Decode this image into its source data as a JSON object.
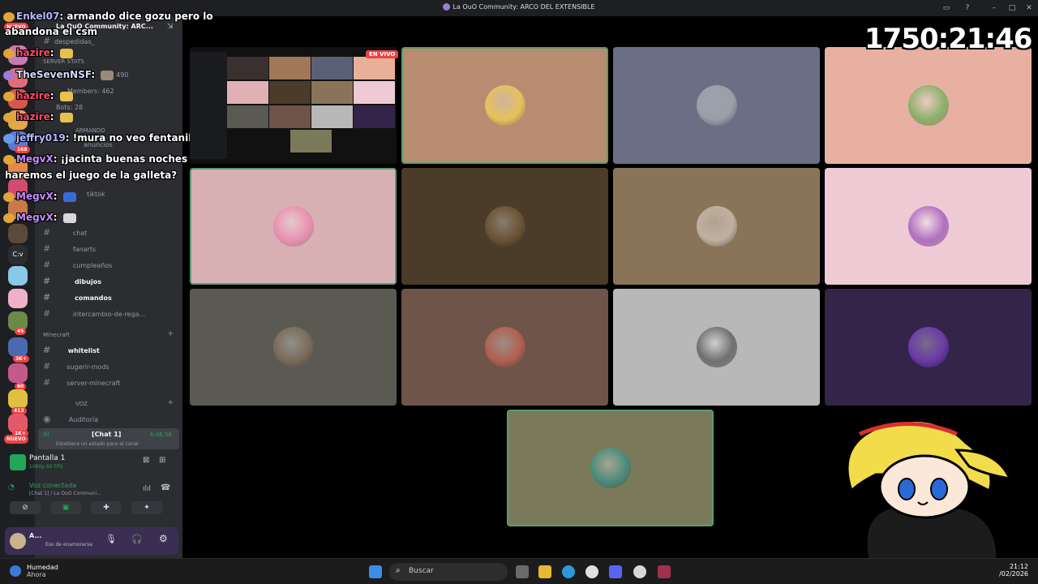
{
  "window": {
    "title": "La OuO Community: ARCO DEL EXTENSIBLE"
  },
  "rail": {
    "badges": [
      "168",
      "45",
      "3K+",
      "60",
      "413",
      "1K+"
    ],
    "nuevo": "NUEVO",
    "cv_label": "C:v"
  },
  "sidebar": {
    "server_name": "La OuO Community: ARC...",
    "channels": [
      {
        "name": "despedidas_",
        "bold": false
      },
      {
        "name": "SERVER STATS",
        "bold": false
      },
      {
        "name": "Members: 462",
        "bold": false
      },
      {
        "name": "Bots: 28",
        "bold": false
      },
      {
        "name": "anuncios",
        "bold": false
      },
      {
        "name": "tiktok",
        "bold": false
      },
      {
        "name": "chat",
        "bold": false
      },
      {
        "name": "fanarts",
        "bold": false
      },
      {
        "name": "cumpleaños",
        "bold": false
      },
      {
        "name": "dibujos",
        "bold": true
      },
      {
        "name": "comandos",
        "bold": true
      },
      {
        "name": "intercambio-de-rega...",
        "bold": false
      }
    ],
    "category_minecraft": "Minecraft",
    "mc_channels": [
      {
        "name": "whitelist",
        "bold": true
      },
      {
        "name": "sugerir-mods",
        "bold": false
      },
      {
        "name": "server-minecraft",
        "bold": false
      }
    ],
    "category_voz": "VOZ",
    "auditoria": "Auditoría",
    "chat1": {
      "name": "[Chat 1]",
      "time": "6:06:56",
      "status": "Establece un estado para el canal"
    },
    "stats_label": "RV: 490",
    "armando_label": "ARMANDO"
  },
  "screen_share": {
    "title": "Pantalla 1",
    "quality": "1080p 60 FPS"
  },
  "voice": {
    "status": "Voz conectada",
    "channel": "[Chat 1] / La OuO Communi..."
  },
  "user": {
    "name": "A...",
    "status": "Eso de enamorarse"
  },
  "chat_overlay": [
    {
      "user": "Enkel07",
      "color": "#b6b9ff",
      "text": "armando dice gozu pero lo"
    },
    {
      "user": "",
      "color": "#fff",
      "text": "abandona el csm"
    },
    {
      "user": "hazire",
      "color": "#ff4a6d",
      "text": ""
    },
    {
      "user": "TheSevenNSF",
      "color": "#d8d8ff",
      "text": ""
    },
    {
      "user": "hazire",
      "color": "#ff4a6d",
      "text": ""
    },
    {
      "user": "hazire",
      "color": "#ff4a6d",
      "text": ""
    },
    {
      "user": "jeffry019",
      "color": "#b6b9ff",
      "text": "!mura no veo fentanillo nafo"
    },
    {
      "user": "MegvX",
      "color": "#c58bff",
      "text": "¡jacinta buenas noches armandito"
    },
    {
      "user": "",
      "color": "#fff",
      "text": "haremos el juego de la galleta?"
    },
    {
      "user": "MegvX",
      "color": "#c58bff",
      "text": ""
    },
    {
      "user": "MegvX",
      "color": "#c58bff",
      "text": ""
    }
  ],
  "live_badge": "EN VIVO",
  "timer": "1750:21:46",
  "tiles": [
    {
      "bg": "#b88c70",
      "avatar": "#e6c25a",
      "speaking": true
    },
    {
      "bg": "#6b6f85",
      "avatar": "#9aa0a8",
      "speaking": false
    },
    {
      "bg": "#e8b0a0",
      "avatar": "#8bb06a",
      "speaking": false
    },
    {
      "bg": "#d8b0b4",
      "avatar": "#e890b0",
      "speaking": true
    },
    {
      "bg": "#4a3c28",
      "avatar": "#6a5234",
      "speaking": false
    },
    {
      "bg": "#8a7458",
      "avatar": "#c0b0a0",
      "speaking": false
    },
    {
      "bg": "#eecbd4",
      "avatar": "#b070c0",
      "speaking": false
    },
    {
      "bg": "#5a5a52",
      "avatar": "#7a6a58",
      "speaking": false
    },
    {
      "bg": "#6e5449",
      "avatar": "#b06050",
      "speaking": false
    },
    {
      "bg": "#b8b8b8",
      "avatar": "#707070",
      "speaking": false
    },
    {
      "bg": "#35244a",
      "avatar": "#6a3aa8",
      "speaking": false
    },
    {
      "bg": "#7a7a5a",
      "avatar": "#4a8a7a",
      "speaking": true
    }
  ],
  "taskbar": {
    "weather_title": "Humedad",
    "weather_sub": "Ahora",
    "search_placeholder": "Buscar",
    "time": "21:12",
    "date": "/02/2026"
  }
}
